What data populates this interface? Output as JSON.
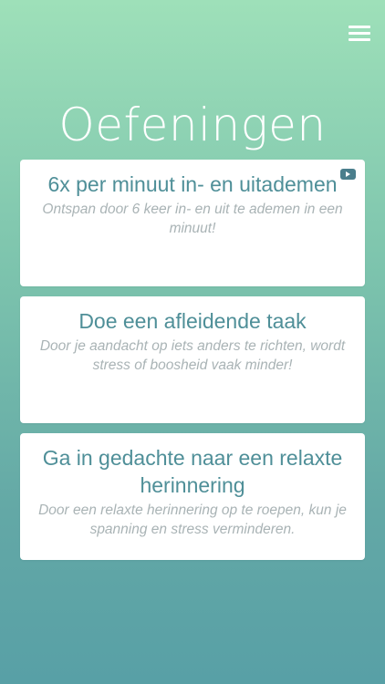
{
  "header": {
    "title": "Oefeningen",
    "menu_icon": "hamburger-menu-icon"
  },
  "exercises": [
    {
      "title": "6x per minuut in- en uitademen",
      "description": "Ontspan door 6 keer in- en uit te ademen in een minuut!",
      "badge_icon": "video-play-icon"
    },
    {
      "title": "Doe een afleidende taak",
      "description": "Door je aandacht op iets anders te richten, wordt stress of boosheid vaak minder!"
    },
    {
      "title": "Ga in gedachte naar een relaxte herinnering",
      "description": "Door een relaxte herinnering op te roepen, kun je spanning en stress verminderen."
    }
  ],
  "colors": {
    "gradient_top": "#9ee0b9",
    "gradient_bottom": "#58a0a6",
    "card_title": "#4f8f98",
    "card_description": "#a9b3b5",
    "video_icon": "#4a7e8c"
  }
}
